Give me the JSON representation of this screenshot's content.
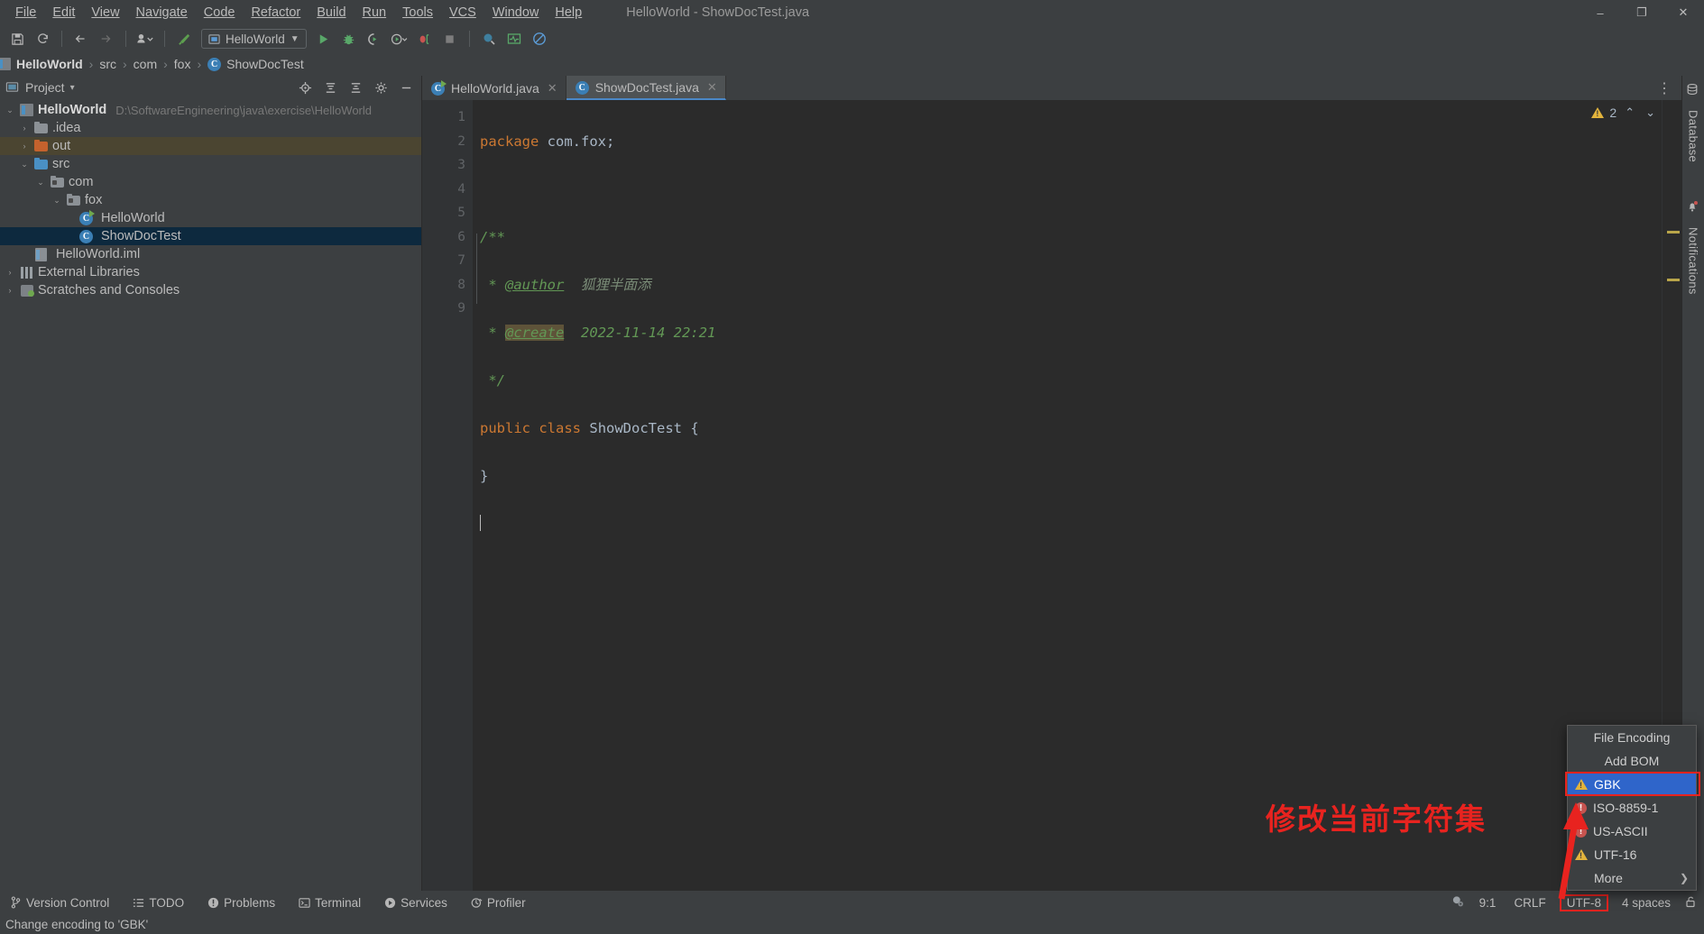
{
  "window": {
    "title": "HelloWorld - ShowDocTest.java",
    "minimize": "–",
    "maximize": "❐",
    "close": "✕"
  },
  "menu": {
    "items": [
      {
        "label": "File"
      },
      {
        "label": "Edit"
      },
      {
        "label": "View"
      },
      {
        "label": "Navigate"
      },
      {
        "label": "Code"
      },
      {
        "label": "Refactor"
      },
      {
        "label": "Build"
      },
      {
        "label": "Run"
      },
      {
        "label": "Tools"
      },
      {
        "label": "VCS"
      },
      {
        "label": "Window"
      },
      {
        "label": "Help"
      }
    ]
  },
  "toolbar": {
    "run_config": "HelloWorld",
    "icons": [
      "save-icon",
      "sync-icon",
      "back-icon",
      "forward-icon",
      "profile-icon",
      "build-icon",
      "run-icon",
      "debug-icon",
      "coverage-icon",
      "profiler-run-icon",
      "attach-icon",
      "stop-icon",
      "search-everywhere-icon",
      "updates-icon",
      "settings-icon"
    ]
  },
  "navbar": {
    "crumbs": [
      {
        "label": "HelloWorld",
        "icon": "module-icon",
        "bold": true
      },
      {
        "label": "src",
        "icon": "source-folder-icon",
        "bold": false
      },
      {
        "label": "com",
        "icon": "package-icon",
        "bold": false
      },
      {
        "label": "fox",
        "icon": "package-icon",
        "bold": false
      },
      {
        "label": "ShowDocTest",
        "icon": "class-icon",
        "bold": false
      }
    ],
    "separator": "›"
  },
  "project_pane": {
    "title": "Project",
    "dropdown": "▾",
    "header_icons": [
      "locate-icon",
      "collapse-all-icon",
      "expand-all-icon",
      "settings-gear-icon",
      "hide-icon"
    ],
    "tree": [
      {
        "label": "HelloWorld",
        "path": "D:\\SoftwareEngineering\\java\\exercise\\HelloWorld",
        "icon": "module-icon",
        "indent": 0,
        "twisty": "⌄",
        "bold": true,
        "state": "normal"
      },
      {
        "label": ".idea",
        "path": "",
        "icon": "folder-icon",
        "indent": 1,
        "twisty": "›",
        "bold": false,
        "state": "normal"
      },
      {
        "label": "out",
        "path": "",
        "icon": "excluded-folder-icon",
        "indent": 1,
        "twisty": "›",
        "bold": false,
        "state": "highlight"
      },
      {
        "label": "src",
        "path": "",
        "icon": "source-folder-icon",
        "indent": 1,
        "twisty": "⌄",
        "bold": false,
        "state": "normal"
      },
      {
        "label": "com",
        "path": "",
        "icon": "package-icon",
        "indent": 2,
        "twisty": "⌄",
        "bold": false,
        "state": "normal"
      },
      {
        "label": "fox",
        "path": "",
        "icon": "package-icon",
        "indent": 3,
        "twisty": "⌄",
        "bold": false,
        "state": "normal"
      },
      {
        "label": "HelloWorld",
        "path": "",
        "icon": "runnable-class-icon",
        "indent": 4,
        "twisty": "",
        "bold": false,
        "state": "normal"
      },
      {
        "label": "ShowDocTest",
        "path": "",
        "icon": "class-icon",
        "indent": 4,
        "twisty": "",
        "bold": false,
        "state": "selected"
      },
      {
        "label": "HelloWorld.iml",
        "path": "",
        "icon": "iml-file-icon",
        "indent": 1,
        "twisty": "",
        "bold": false,
        "state": "normal"
      },
      {
        "label": "External Libraries",
        "path": "",
        "icon": "library-icon",
        "indent": 0,
        "twisty": "›",
        "bold": false,
        "state": "normal"
      },
      {
        "label": "Scratches and Consoles",
        "path": "",
        "icon": "scratches-icon",
        "indent": 0,
        "twisty": "›",
        "bold": false,
        "state": "normal"
      }
    ]
  },
  "editor": {
    "tabs": [
      {
        "label": "HelloWorld.java",
        "icon": "runnable-class-icon",
        "active": false,
        "close": "✕"
      },
      {
        "label": "ShowDocTest.java",
        "icon": "class-icon",
        "active": true,
        "close": "✕"
      }
    ],
    "tab_overflow": "⋮",
    "gutter_lines": [
      "1",
      "2",
      "3",
      "4",
      "5",
      "6",
      "7",
      "8",
      "9"
    ],
    "code": {
      "line1_kw": "package",
      "line1_rest": " com.fox;",
      "line3": "/**",
      "line4_star": " * ",
      "line4_tag": "@author",
      "line4_value": "  狐狸半面添",
      "line5_star": " * ",
      "line5_tag": "@create",
      "line5_value": "  2022-11-14 22:21",
      "line6": " */",
      "line7_kw1": "public",
      "line7_kw2": "class",
      "line7_name": "ShowDocTest",
      "line7_brace": "{",
      "line8": "}"
    },
    "inspection": {
      "warning_count": "2",
      "up": "⌃",
      "down": "⌄"
    },
    "annotation": "修改当前字符集"
  },
  "right_strip": {
    "items": [
      {
        "label": "Database",
        "icon": "database-icon"
      },
      {
        "label": "Notifications",
        "icon": "notifications-icon"
      }
    ]
  },
  "statusbar": {
    "left_items": [
      {
        "label": "Version Control",
        "icon": "branch-icon"
      },
      {
        "label": "TODO",
        "icon": "todo-icon"
      },
      {
        "label": "Problems",
        "icon": "problems-icon"
      },
      {
        "label": "Terminal",
        "icon": "terminal-icon"
      },
      {
        "label": "Services",
        "icon": "services-icon"
      },
      {
        "label": "Profiler",
        "icon": "profiler-icon"
      }
    ],
    "message": "Change encoding to 'GBK'",
    "right_items": {
      "event_log_icon": "event-log-icon",
      "caret_position": "9:1",
      "line_separator": "CRLF",
      "encoding": "UTF-8",
      "indent": "4 spaces",
      "lock_icon": "unlocked-icon"
    }
  },
  "encoding_popup": {
    "header": "File Encoding",
    "items": [
      {
        "label": "Add BOM",
        "badge": "none",
        "selected": false,
        "centered": true,
        "arrow": ""
      },
      {
        "label": "GBK",
        "badge": "warn",
        "selected": true,
        "centered": false,
        "arrow": ""
      },
      {
        "label": "ISO-8859-1",
        "badge": "error",
        "selected": false,
        "centered": false,
        "arrow": ""
      },
      {
        "label": "US-ASCII",
        "badge": "error",
        "selected": false,
        "centered": false,
        "arrow": ""
      },
      {
        "label": "UTF-16",
        "badge": "warn",
        "selected": false,
        "centered": false,
        "arrow": ""
      },
      {
        "label": "More",
        "badge": "none",
        "selected": false,
        "centered": false,
        "arrow": "❯"
      }
    ]
  },
  "colors": {
    "accent_blue": "#2f65ca",
    "highlight_red": "#e8231f",
    "warning_yellow": "#e2b33c",
    "error_red": "#c75450",
    "bg_chrome": "#3c3f41",
    "bg_editor": "#2b2b2b",
    "selection_blue": "#0d293e"
  }
}
